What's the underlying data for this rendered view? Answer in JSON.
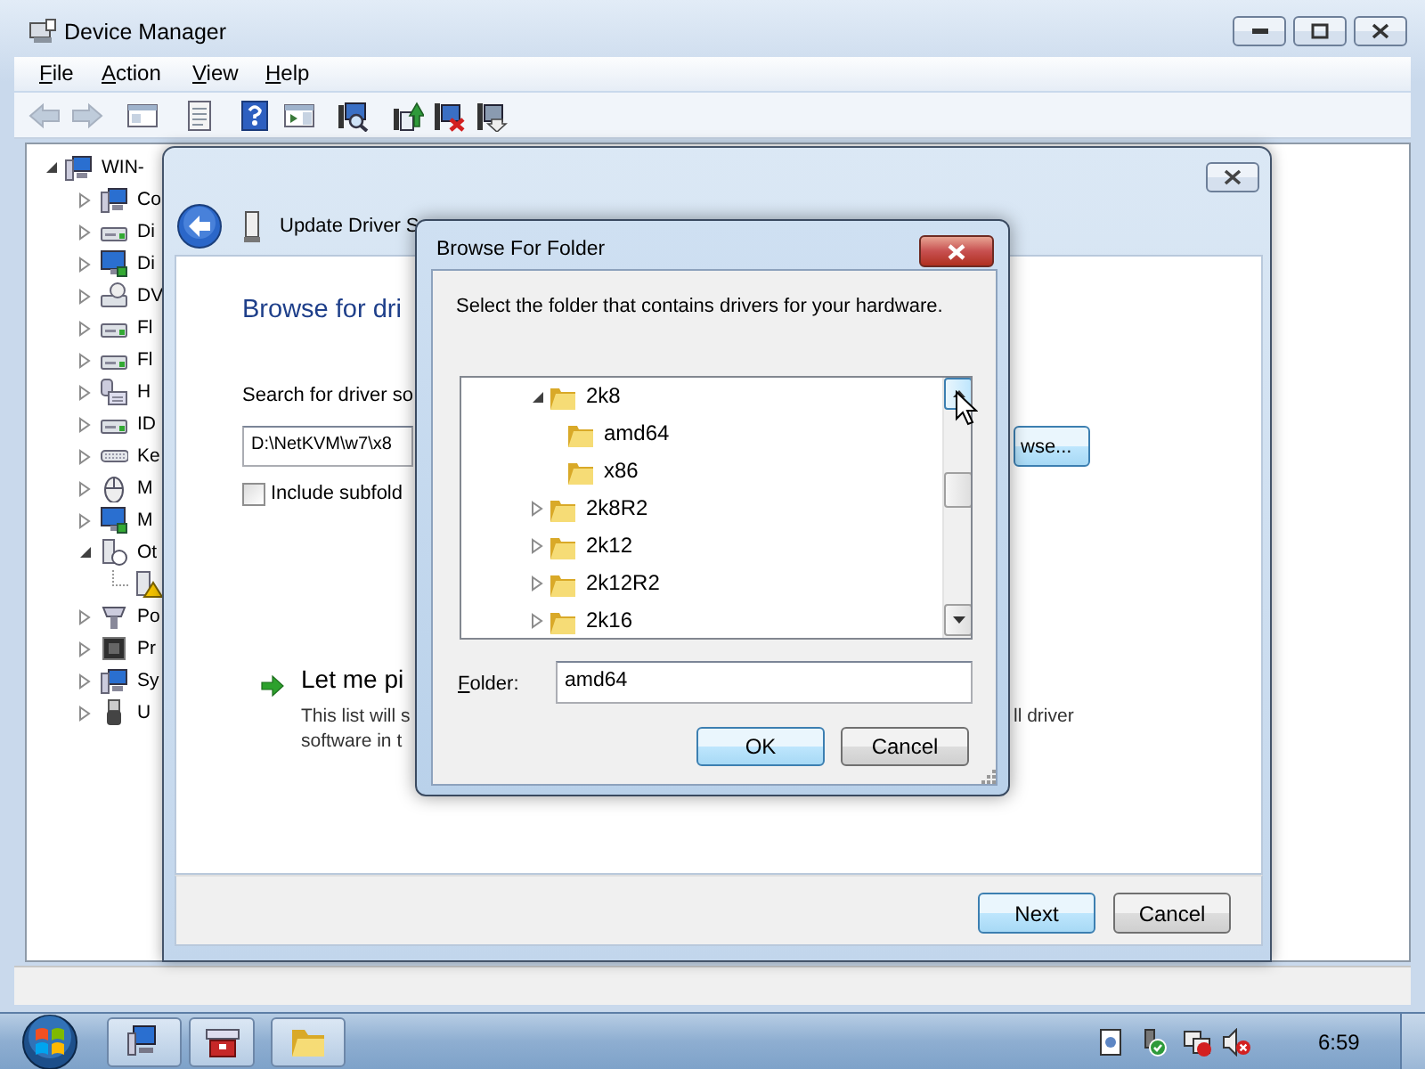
{
  "window": {
    "title": "Device Manager"
  },
  "menu": [
    "File",
    "Action",
    "View",
    "Help"
  ],
  "toolbar": [
    {
      "kind": "back",
      "disabled": true
    },
    {
      "kind": "forward",
      "disabled": true
    },
    {
      "kind": "console-tree",
      "disabled": false
    },
    {
      "kind": "properties",
      "disabled": false
    },
    {
      "kind": "help",
      "disabled": false
    },
    {
      "kind": "action-pane",
      "disabled": false
    },
    {
      "kind": "scan",
      "disabled": false
    },
    {
      "kind": "update-driver",
      "disabled": false
    },
    {
      "kind": "uninstall",
      "disabled": false
    },
    {
      "kind": "disable",
      "disabled": false
    }
  ],
  "device_tree": {
    "label": "WIN-",
    "kind": "computer",
    "expanded": true,
    "children": [
      {
        "label": "Co",
        "kind": "computer",
        "expanded": false
      },
      {
        "label": "Di",
        "kind": "disk",
        "expanded": false
      },
      {
        "label": "Di",
        "kind": "display",
        "expanded": false
      },
      {
        "label": "DV",
        "kind": "dvd",
        "expanded": false
      },
      {
        "label": "Fl",
        "kind": "disk",
        "expanded": false
      },
      {
        "label": "Fl",
        "kind": "disk",
        "expanded": false
      },
      {
        "label": "H",
        "kind": "hid",
        "expanded": false
      },
      {
        "label": "ID",
        "kind": "disk",
        "expanded": false
      },
      {
        "label": "Ke",
        "kind": "keyboard",
        "expanded": false
      },
      {
        "label": "M",
        "kind": "mouse",
        "expanded": false
      },
      {
        "label": "M",
        "kind": "display",
        "expanded": false
      },
      {
        "label": "Ot",
        "kind": "other",
        "expanded": true,
        "children": [
          {
            "kind": "unknown-device"
          }
        ]
      },
      {
        "label": "Po",
        "kind": "port",
        "expanded": false
      },
      {
        "label": "Pr",
        "kind": "processor",
        "expanded": false
      },
      {
        "label": "Sy",
        "kind": "computer",
        "expanded": false
      },
      {
        "label": "U",
        "kind": "usb",
        "expanded": false
      }
    ]
  },
  "wizard": {
    "title": "Update Driver S",
    "heading": "Browse for dri",
    "search_label": "Search for driver so",
    "path": "D:\\NetKVM\\w7\\x8",
    "browse_button": "wse...",
    "include_subfolders": {
      "label": "Include subfold",
      "checked": false
    },
    "option": {
      "title": "Let me pi",
      "description_lines": [
        "This list will s",
        "software in t"
      ],
      "description_right": "ll driver"
    },
    "buttons": [
      {
        "label": "Next",
        "default": true
      },
      {
        "label": "Cancel",
        "default": false
      }
    ]
  },
  "browse_dialog": {
    "title": "Browse For Folder",
    "prompt": "Select the folder that contains drivers for your hardware.",
    "folders": [
      {
        "label": "2k8",
        "expanded": true,
        "children": [
          {
            "label": "amd64"
          },
          {
            "label": "x86"
          }
        ]
      },
      {
        "label": "2k8R2",
        "expanded": false
      },
      {
        "label": "2k12",
        "expanded": false
      },
      {
        "label": "2k12R2",
        "expanded": false
      },
      {
        "label": "2k16",
        "expanded": false
      }
    ],
    "folder_label": "Folder:",
    "folder_value": "amd64",
    "buttons": [
      {
        "label": "OK",
        "default": true
      },
      {
        "label": "Cancel",
        "default": false
      }
    ]
  },
  "taskbar": {
    "buttons": [
      {
        "kind": "device-manager"
      },
      {
        "kind": "toolbox"
      },
      {
        "kind": "explorer"
      }
    ],
    "tray": [
      {
        "kind": "document"
      },
      {
        "kind": "usb-safe"
      },
      {
        "kind": "network-error"
      },
      {
        "kind": "volume-muted"
      }
    ],
    "clock": "6:59"
  }
}
